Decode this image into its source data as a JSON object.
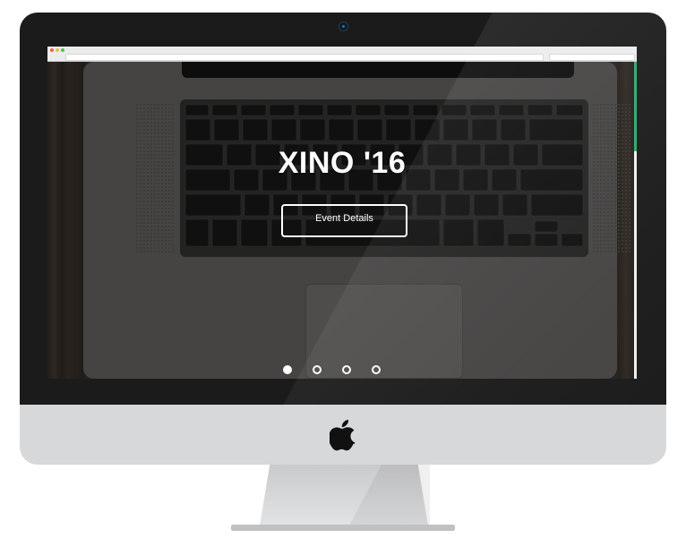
{
  "hero": {
    "title": "XINO '16",
    "button_label": "Event Details",
    "slides": [
      {
        "active": true
      },
      {
        "active": false
      },
      {
        "active": false
      },
      {
        "active": false
      }
    ]
  },
  "colors": {
    "accent_scrollbar": "#2fa96b",
    "monitor_bezel": "#1b1b1b",
    "monitor_chin": "#d7d8da",
    "browser_dots": [
      "#f25f58",
      "#f9be3d",
      "#48c94a"
    ]
  },
  "icons": {
    "monitor_logo": "apple-logo-icon",
    "camera": "camera-icon"
  }
}
